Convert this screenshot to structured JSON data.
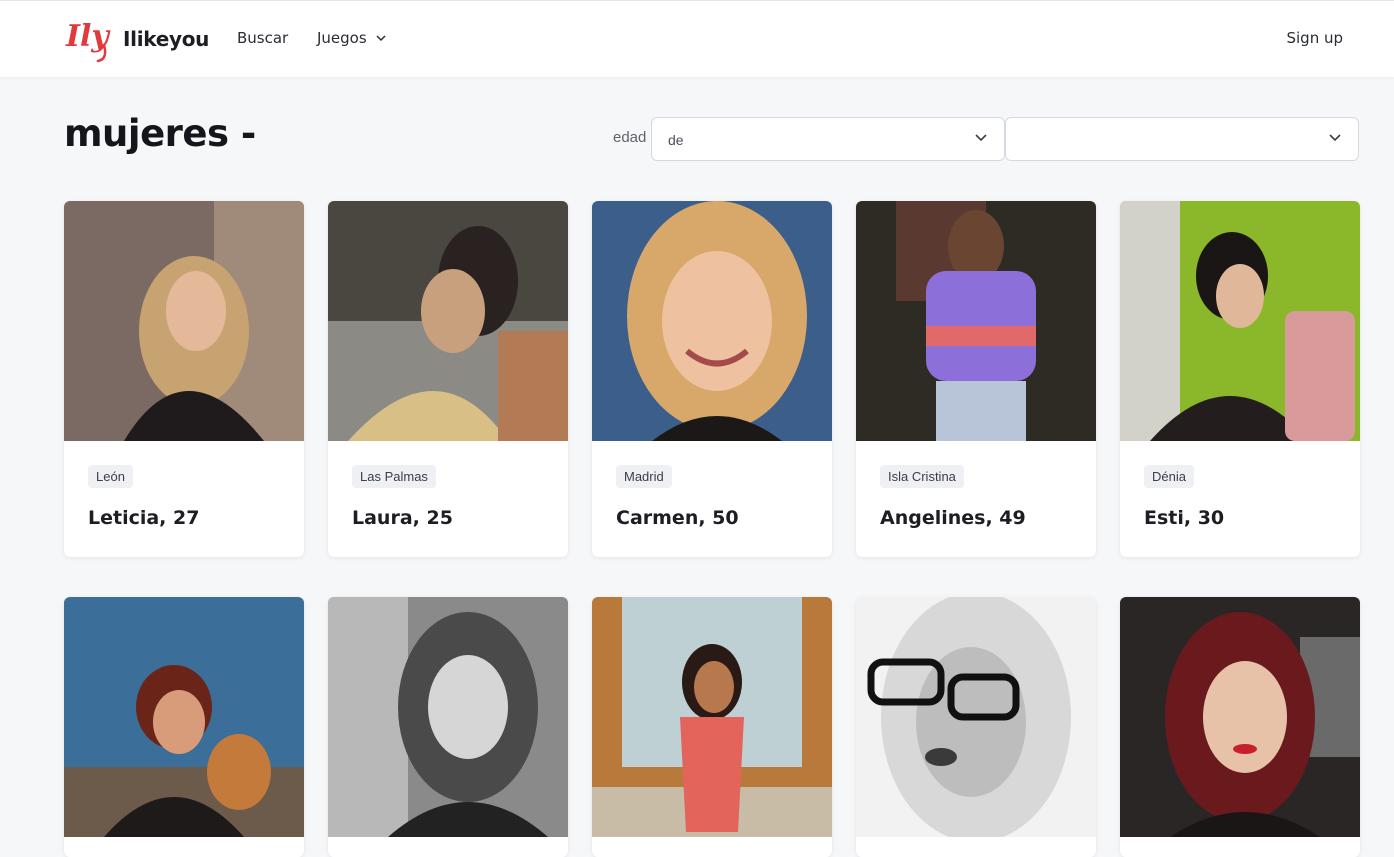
{
  "header": {
    "logo_mark": "Ily",
    "brand": "Ilikeyou",
    "nav": {
      "search": "Buscar",
      "games": "Juegos"
    },
    "signup": "Sign up"
  },
  "page": {
    "title": "mujeres -",
    "age_filter": {
      "label": "edad",
      "from_value": "de",
      "to_value": ""
    }
  },
  "profiles": [
    {
      "city": "León",
      "name": "Leticia, 27"
    },
    {
      "city": "Las Palmas",
      "name": "Laura, 25"
    },
    {
      "city": "Madrid",
      "name": "Carmen, 50"
    },
    {
      "city": "Isla Cristina",
      "name": "Angelines, 49"
    },
    {
      "city": "Dénia",
      "name": "Esti, 30"
    },
    {
      "city": "",
      "name": ""
    },
    {
      "city": "",
      "name": ""
    },
    {
      "city": "",
      "name": ""
    },
    {
      "city": "",
      "name": ""
    },
    {
      "city": "",
      "name": ""
    }
  ],
  "colors": {
    "brand_red": "#e0393e",
    "page_bg": "#f6f7f9",
    "tag_bg": "#eef0f4"
  }
}
